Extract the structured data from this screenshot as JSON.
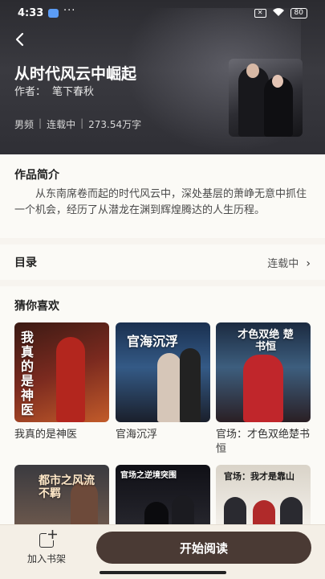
{
  "status_bar": {
    "time": "4:33",
    "dots": "···",
    "sim": "✕",
    "battery": "80"
  },
  "book": {
    "title": "从时代风云中崛起",
    "author_label": "作者：",
    "author": "笔下春秋",
    "category": "男频",
    "status": "连载中",
    "word_count": "273.54万字"
  },
  "intro": {
    "heading": "作品简介",
    "text": "从东南席卷而起的时代风云中，深处基层的萧峥无意中抓住一个机会，经历了从潜龙在渊到辉煌腾达的人生历程。"
  },
  "toc": {
    "label": "目录",
    "status": "连载中",
    "chevron": "›"
  },
  "recommendations": {
    "heading": "猜你喜欢",
    "items": [
      {
        "name": "我真的是神医",
        "cover_text": "我真的是神医"
      },
      {
        "name": "官海沉浮",
        "cover_text": "官海沉浮"
      },
      {
        "name": "官场：才色双绝楚书恒",
        "cover_text": "才色双绝 楚书恒"
      },
      {
        "name": "",
        "cover_text": "都市之风流不羁"
      },
      {
        "name": "",
        "cover_text": "官场之逆境突围"
      },
      {
        "name": "",
        "cover_text": "官场：我才是靠山"
      }
    ]
  },
  "bottom_bar": {
    "add_shelf": "加入书架",
    "start_reading": "开始阅读"
  },
  "colors": {
    "primary_button": "#4a3a34",
    "page_bg": "#f7f4ef"
  }
}
